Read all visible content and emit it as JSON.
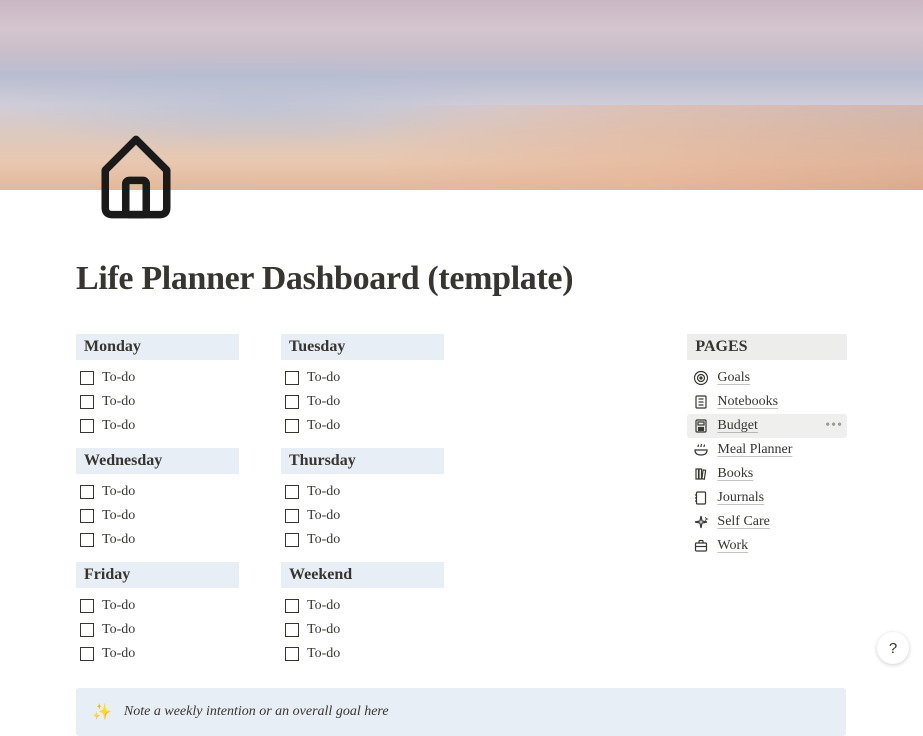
{
  "title": "Life Planner Dashboard (template)",
  "days": [
    {
      "name": "Monday",
      "todos": [
        "To-do",
        "To-do",
        "To-do"
      ]
    },
    {
      "name": "Tuesday",
      "todos": [
        "To-do",
        "To-do",
        "To-do"
      ]
    },
    {
      "name": "Wednesday",
      "todos": [
        "To-do",
        "To-do",
        "To-do"
      ]
    },
    {
      "name": "Thursday",
      "todos": [
        "To-do",
        "To-do",
        "To-do"
      ]
    },
    {
      "name": "Friday",
      "todos": [
        "To-do",
        "To-do",
        "To-do"
      ]
    },
    {
      "name": "Weekend",
      "todos": [
        "To-do",
        "To-do",
        "To-do"
      ]
    }
  ],
  "pages": {
    "header": "PAGES",
    "items": [
      {
        "icon": "target",
        "label": "Goals",
        "hover": false
      },
      {
        "icon": "notebook",
        "label": "Notebooks",
        "hover": false
      },
      {
        "icon": "calc",
        "label": "Budget",
        "hover": true
      },
      {
        "icon": "bowl",
        "label": "Meal Planner",
        "hover": false
      },
      {
        "icon": "shelf",
        "label": "Books",
        "hover": false
      },
      {
        "icon": "journal",
        "label": "Journals",
        "hover": false
      },
      {
        "icon": "sparkle",
        "label": "Self Care",
        "hover": false
      },
      {
        "icon": "brief",
        "label": "Work",
        "hover": false
      }
    ]
  },
  "callout": {
    "icon": "✨",
    "text": "Note a weekly intention or an overall goal here"
  },
  "help": "?"
}
